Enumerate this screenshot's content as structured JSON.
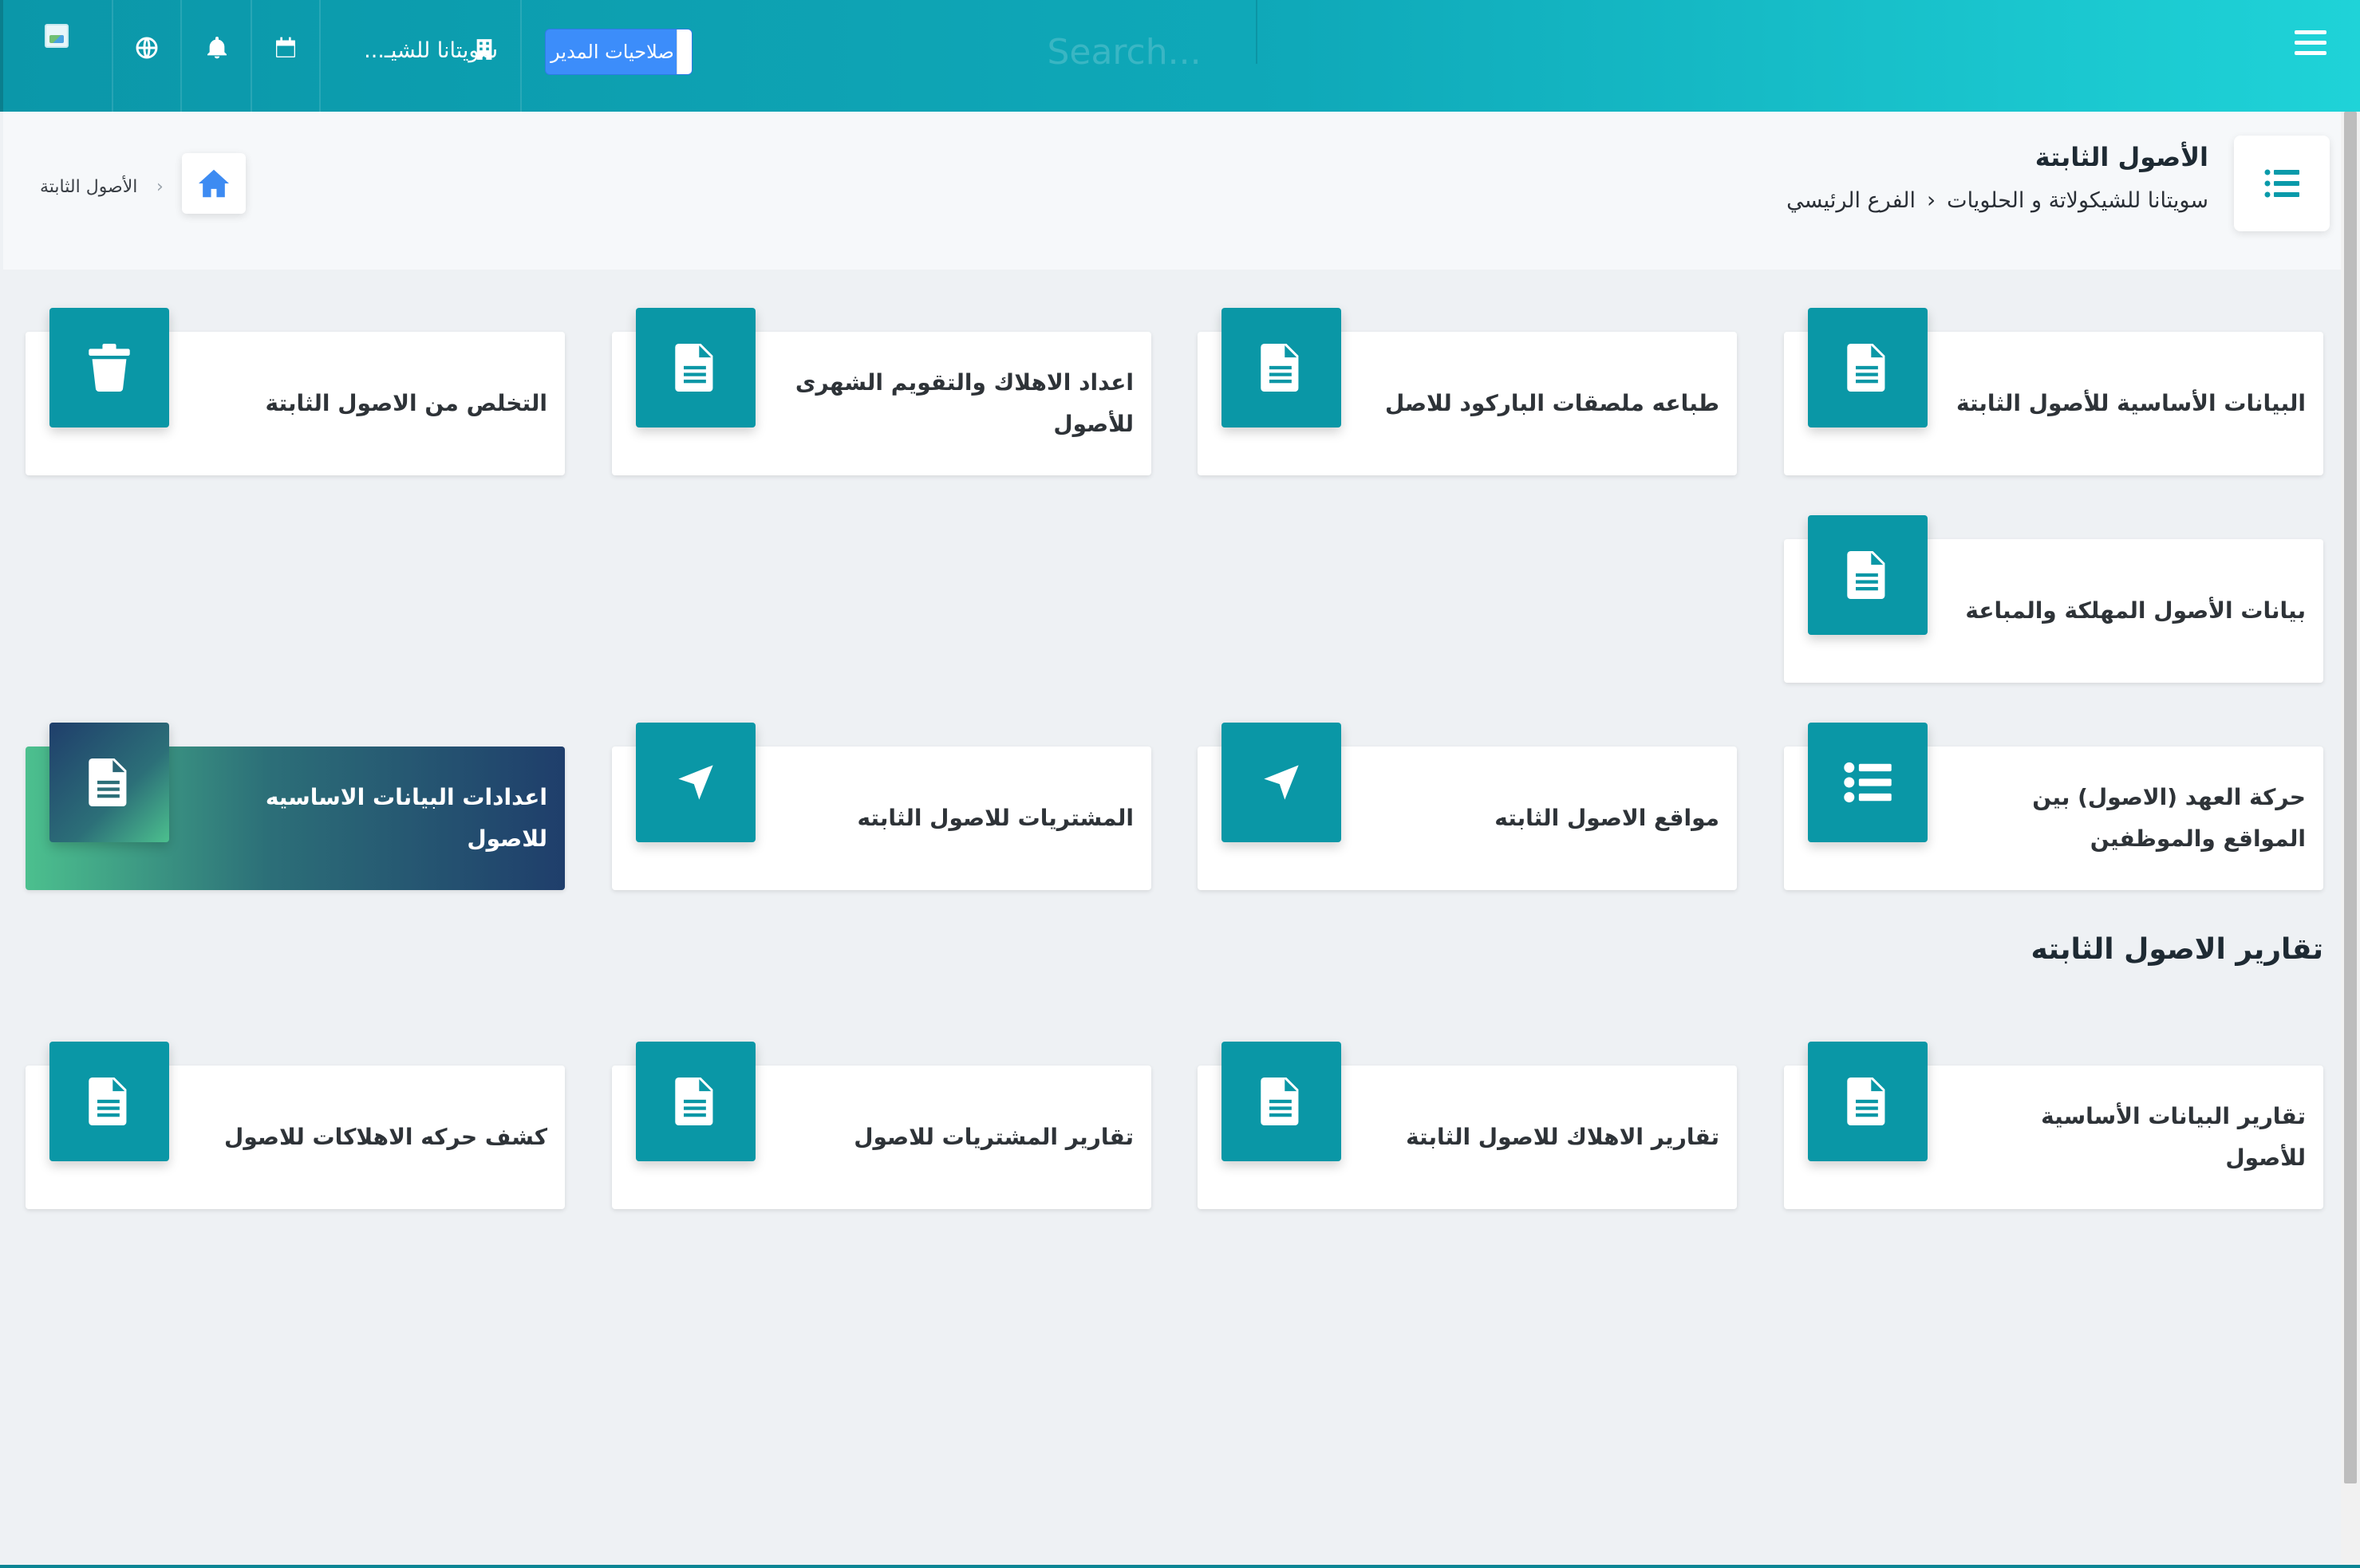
{
  "topbar": {
    "branch_name": "سويتانا للشيـ...",
    "admin_button": "صلاحيات المدير",
    "search_placeholder": "Search...",
    "icons": [
      "globe-icon",
      "bell-icon",
      "calendar-icon",
      "building-icon",
      "hamburger-icon"
    ]
  },
  "header": {
    "title": "الأصول الثابتة",
    "company": "سويتانا للشيكولاتة و الحلويات",
    "branch": "الفرع الرئيسي",
    "crumb": "الأصول الثابتة"
  },
  "cards": [
    {
      "label": "البيانات الأساسية للأصول الثابتة",
      "icon": "file-icon"
    },
    {
      "label": "طباعه ملصقات الباركود للاصل",
      "icon": "file-icon"
    },
    {
      "label": "اعداد الاهلاك والتقويم الشهرى للأصول",
      "icon": "file-icon"
    },
    {
      "label": "التخلص من الاصول الثابتة",
      "icon": "trash-icon"
    },
    {
      "label": "بيانات الأصول المهلكة والمباعة",
      "icon": "file-icon"
    },
    {
      "label": "حركة العهد (الاصول) بين المواقع والموظفين",
      "icon": "list-icon"
    },
    {
      "label": "مواقع الاصول الثابته",
      "icon": "location-arrow-icon"
    },
    {
      "label": "المشتريات للاصول الثابته",
      "icon": "location-arrow-icon"
    },
    {
      "label": "اعدادات البيانات الاساسيه للاصول",
      "icon": "file-icon"
    }
  ],
  "reports": {
    "title": "تقارير الاصول الثابته",
    "cards": [
      {
        "label": "تقارير البيانات الأساسية للأصول",
        "icon": "file-icon"
      },
      {
        "label": "تقارير الاهلاك للاصول الثابتة",
        "icon": "file-icon"
      },
      {
        "label": "تقارير المشتريات للاصول",
        "icon": "file-icon"
      },
      {
        "label": "كشف حركه الاهلاكات للاصول",
        "icon": "file-icon"
      }
    ]
  },
  "colors": {
    "accent": "#0a97a6",
    "topbar_start": "#0b97a9",
    "topbar_end": "#1fd3d8",
    "admin_button": "#3c8dfa",
    "home_icon": "#3d8bf2"
  }
}
